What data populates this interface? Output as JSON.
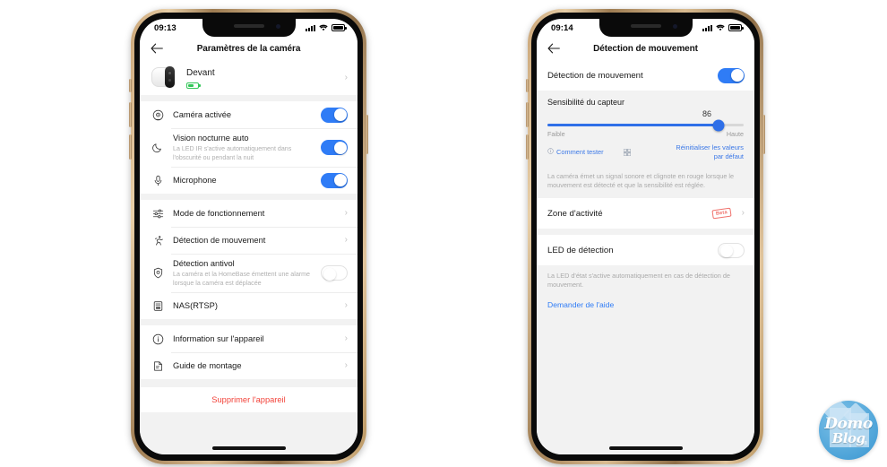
{
  "left_phone": {
    "status_bar": {
      "time": "09:13",
      "signal_icon": "signal-bars-icon",
      "wifi_icon": "wifi-icon",
      "battery_icon": "battery-icon"
    },
    "nav": {
      "back_icon": "back-arrow-icon",
      "title": "Paramètres de la caméra"
    },
    "device": {
      "name": "Devant",
      "thumbnail_icon": "camera-thumbnail-icon",
      "battery_icon": "battery-green-icon",
      "chevron": "›"
    },
    "groups": [
      {
        "rows": [
          {
            "icon": "camera-icon",
            "title": "Caméra activée",
            "sub": "",
            "control": "toggle",
            "state": "on"
          },
          {
            "icon": "moon-icon",
            "title": "Vision nocturne auto",
            "sub": "La LED IR s'active automatiquement dans l'obscurité ou pendant la nuit",
            "control": "toggle",
            "state": "on"
          },
          {
            "icon": "microphone-icon",
            "title": "Microphone",
            "sub": "",
            "control": "toggle",
            "state": "on"
          }
        ]
      },
      {
        "rows": [
          {
            "icon": "sliders-icon",
            "title": "Mode de fonctionnement",
            "sub": "",
            "control": "chevron",
            "state": ""
          },
          {
            "icon": "motion-icon",
            "title": "Détection de mouvement",
            "sub": "",
            "control": "chevron",
            "state": ""
          },
          {
            "icon": "shield-icon",
            "title": "Détection antivol",
            "sub": "La caméra et la HomeBase émettent une alarme lorsque la caméra est déplacée",
            "control": "toggle",
            "state": "off"
          },
          {
            "icon": "nas-icon",
            "title": "NAS(RTSP)",
            "sub": "",
            "control": "chevron",
            "state": ""
          }
        ]
      },
      {
        "rows": [
          {
            "icon": "info-icon",
            "title": "Information sur l'appareil",
            "sub": "",
            "control": "chevron",
            "state": ""
          },
          {
            "icon": "guide-icon",
            "title": "Guide de montage",
            "sub": "",
            "control": "chevron",
            "state": ""
          }
        ]
      }
    ],
    "delete_label": "Supprimer l'appareil"
  },
  "right_phone": {
    "status_bar": {
      "time": "09:14",
      "signal_icon": "signal-bars-icon",
      "wifi_icon": "wifi-icon",
      "battery_icon": "battery-icon"
    },
    "nav": {
      "back_icon": "back-arrow-icon",
      "title": "Détection de mouvement"
    },
    "motion_row": {
      "title": "Détection de mouvement",
      "control": "toggle",
      "state": "on"
    },
    "sensitivity": {
      "label": "Sensibilité du capteur",
      "value": "86",
      "percent": 87,
      "min_label": "Faible",
      "max_label": "Haute",
      "how_to_test": "Comment tester",
      "how_to_test_icon": "info-circle-icon",
      "qr_icon": "qr-code-icon",
      "reset_label": "Réinitialiser les valeurs par défaut",
      "accent": "#2f6fe8"
    },
    "sensitivity_help": "La caméra émet un signal sonore et clignote en rouge lorsque le mouvement est détecté et que la sensibilité est réglée.",
    "activity_zone": {
      "title": "Zone d'activité",
      "badge": "Beta",
      "badge_color": "#f0736d",
      "chevron": "›"
    },
    "detection_led": {
      "title": "LED de détection",
      "control": "toggle",
      "state": "off"
    },
    "led_help": "La LED d'état s'active automatiquement en cas de détection de mouvement.",
    "help_link": "Demander de l'aide"
  },
  "watermark": {
    "line1": "Domo",
    "line2": "Blog",
    "registered": "®",
    "icon": "domo-blog-logo"
  }
}
